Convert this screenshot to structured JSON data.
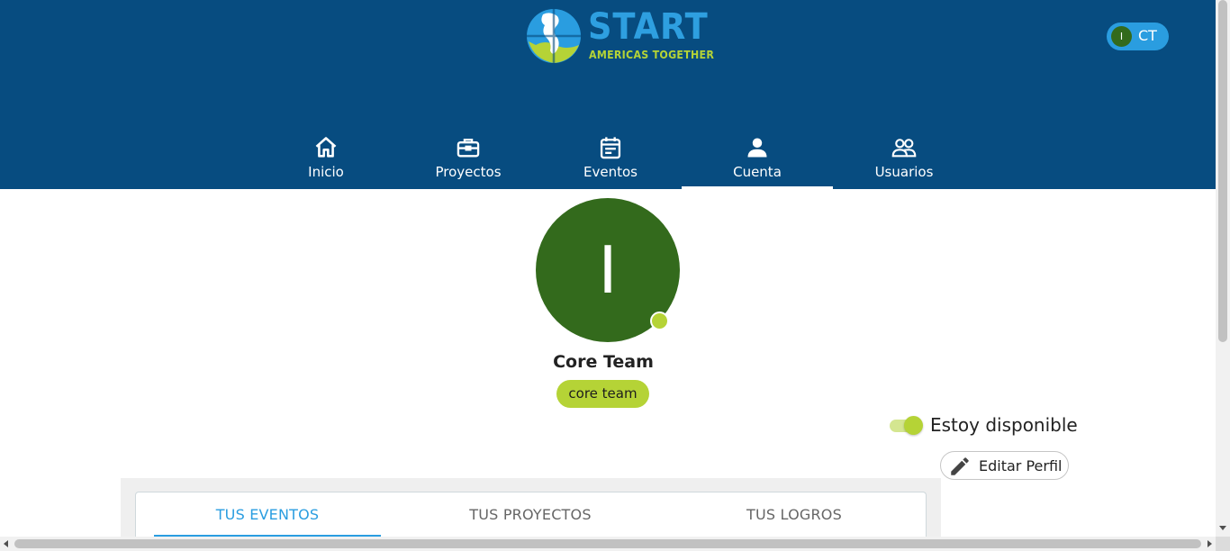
{
  "brand": {
    "name": "START",
    "tagline": "AMERICAS TOGETHER",
    "colors": {
      "header": "#074c80",
      "accent_blue": "#2a9de0",
      "accent_green": "#b5d336",
      "avatar_green": "#336a1c"
    }
  },
  "user_chip": {
    "avatar_letter": "I",
    "initials": "CT"
  },
  "nav": {
    "items": [
      {
        "label": "Inicio",
        "icon": "home-icon"
      },
      {
        "label": "Proyectos",
        "icon": "briefcase-icon"
      },
      {
        "label": "Eventos",
        "icon": "calendar-icon"
      },
      {
        "label": "Cuenta",
        "icon": "user-icon",
        "active": true
      },
      {
        "label": "Usuarios",
        "icon": "users-icon"
      }
    ]
  },
  "profile": {
    "avatar_letter": "I",
    "name": "Core Team",
    "role": "core team",
    "availability_label": "Estoy disponible",
    "available": true,
    "edit_label": "Editar Perfil"
  },
  "tabs": [
    {
      "label": "TUS EVENTOS",
      "active": true
    },
    {
      "label": "TUS PROYECTOS"
    },
    {
      "label": "TUS LOGROS"
    }
  ]
}
